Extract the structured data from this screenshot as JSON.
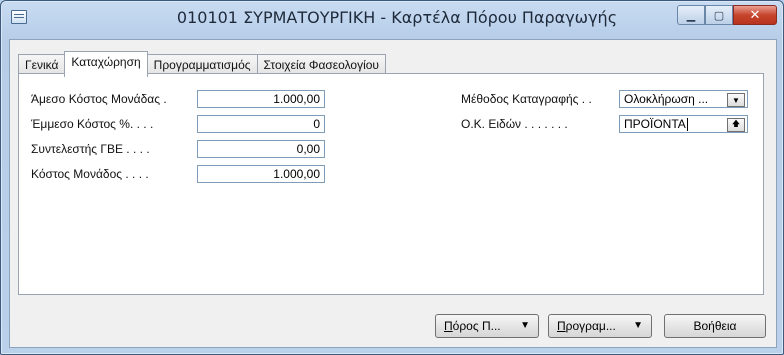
{
  "window": {
    "title": "010101 ΣΥΡΜΑΤΟΥΡΓΙΚΗ - Καρτέλα Πόρου Παραγωγής",
    "controls": {
      "minimize": "▁",
      "maximize": "▢",
      "close": "✕"
    }
  },
  "tabs": [
    {
      "label": "Γενικά",
      "active": false
    },
    {
      "label": "Καταχώρηση",
      "active": true
    },
    {
      "label": "Προγραμματισμός",
      "active": false
    },
    {
      "label": "Στοιχεία Φασεολογίου",
      "active": false
    }
  ],
  "left_fields": [
    {
      "label": "Άμεσο Κόστος Μονάδας .",
      "value": "1.000,00"
    },
    {
      "label": "Έμμεσο Κόστος %. . . .",
      "value": "0"
    },
    {
      "label": "Συντελεστής ΓΒΕ . . . .",
      "value": "0,00"
    },
    {
      "label": "Κόστος Μονάδος . . . .",
      "value": "1.000,00"
    }
  ],
  "right_fields": [
    {
      "label": "Μέθοδος Καταγραφής . .",
      "value": "Ολοκλήρωση ...",
      "button": "▼"
    },
    {
      "label": "Ο.Κ. Ειδών . . . . . . .",
      "value": "ΠΡΟΪΟΝΤΑ",
      "button": "🡅"
    }
  ],
  "buttons": {
    "resource_first": "Π",
    "resource_rest": "όρος Π...",
    "resource_arrow": "▼",
    "plan_first": "Π",
    "plan_rest": "ρογραμ...",
    "plan_arrow": "▼",
    "help": "Βοήθεια"
  }
}
